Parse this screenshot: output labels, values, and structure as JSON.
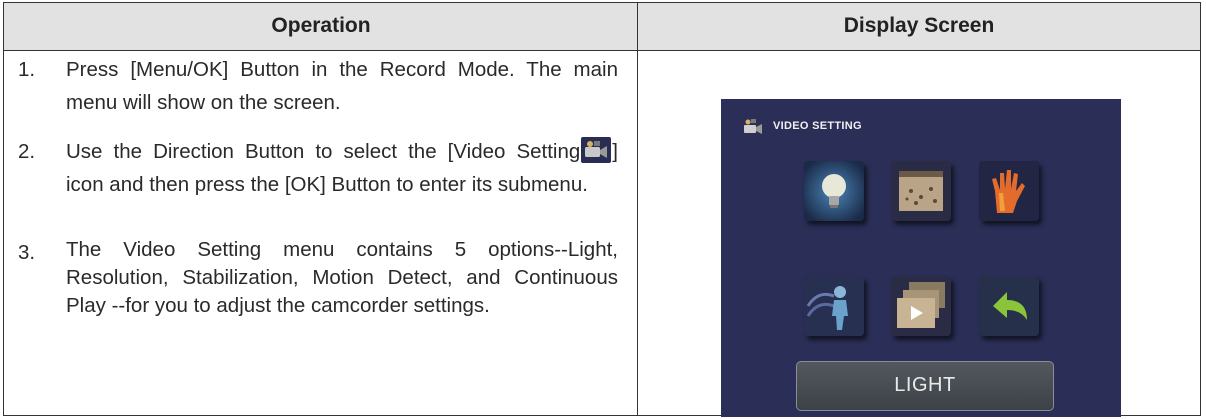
{
  "table": {
    "headers": {
      "operation": "Operation",
      "display_screen": "Display Screen"
    },
    "steps": [
      {
        "num": "1.",
        "text": "Press [Menu/OK] Button in the Record Mode. The main menu will show on the screen."
      },
      {
        "num": "2.",
        "text_before": "Use the Direction Button to select the [Video Setting",
        "icon": "video-setting-icon",
        "text_after": "] icon and then press the [OK] Button to enter its submenu."
      },
      {
        "num": "3.",
        "text": "The Video Setting menu contains 5 options--Light, Resolution, Stabilization, Motion Detect, and Continuous Play --for you to adjust the camcorder settings."
      }
    ]
  },
  "screen": {
    "title": "VIDEO SETTING",
    "title_icon": "video-setting-icon",
    "options": [
      {
        "icon": "light-bulb-icon"
      },
      {
        "icon": "resolution-icon"
      },
      {
        "icon": "stabilization-hand-icon"
      },
      {
        "icon": "motion-detect-icon"
      },
      {
        "icon": "continuous-play-icon"
      },
      {
        "icon": "return-arrow-icon"
      }
    ],
    "selected_label": "LIGHT",
    "background_color": "#2b2f57"
  }
}
